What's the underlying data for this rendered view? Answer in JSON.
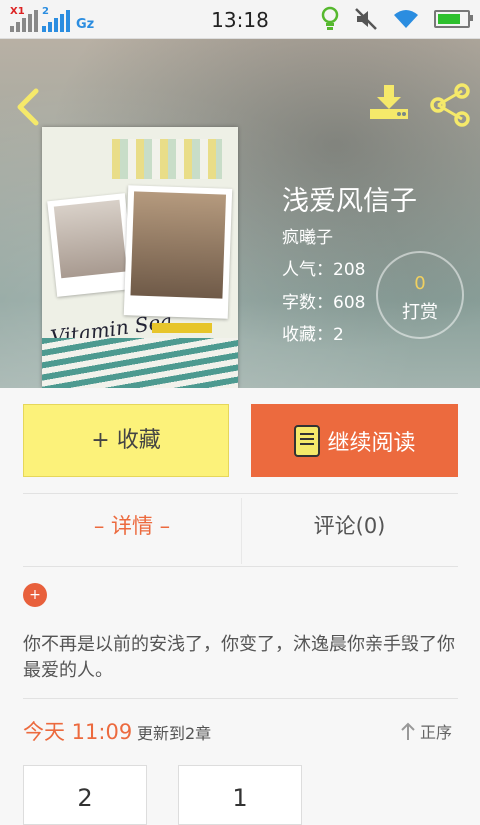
{
  "status_bar": {
    "sim1_tag": "X1",
    "sim2_tag": "2",
    "network": "Gz",
    "time": "13:18",
    "battery_level": 0.8,
    "icons": [
      "signal-icon",
      "signal-icon",
      "bulb-icon",
      "mute-icon",
      "wifi-icon",
      "battery-icon"
    ]
  },
  "book": {
    "title": "浅爱风信子",
    "author": "疯曦子",
    "popularity": "人气：208",
    "word_count": "字数：608",
    "favorites": "收藏：2",
    "reward_count": "0",
    "reward_label": "打赏",
    "cover_text": "Vitamin Sea"
  },
  "actions": {
    "favorite_label": "+ 收藏",
    "continue_label": "继续阅读"
  },
  "tabs": {
    "detail": "– 详情 –",
    "comments": "评论(0)"
  },
  "description": "你不再是以前的安浅了，你变了，沐逸晨你亲手毁了你最爱的人。",
  "update": {
    "day": "今天 11:09",
    "info": "更新到2章",
    "sort_label": "正序"
  },
  "chapters": [
    "2",
    "1"
  ],
  "colors": {
    "accent": "#ec6a3e",
    "favorite_button": "#fcf27a",
    "icon_yellow": "#f5e96a"
  }
}
